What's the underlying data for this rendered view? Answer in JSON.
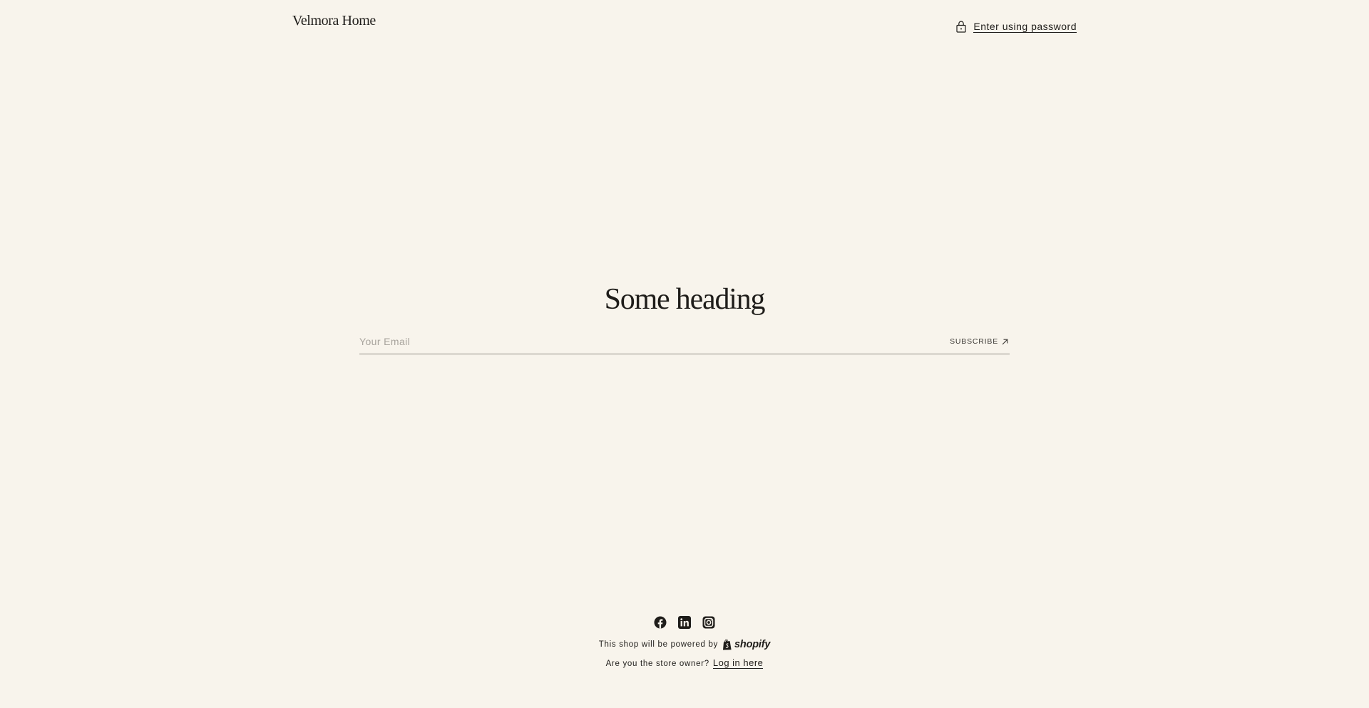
{
  "header": {
    "brand": "Velmora Home",
    "password_link": "Enter using password",
    "password_icon": "lock-icon"
  },
  "hero": {
    "heading": "Some heading",
    "email_placeholder": "Your Email",
    "subscribe_label": "SUBSCRIBE",
    "subscribe_icon": "arrow-up-right-icon"
  },
  "footer": {
    "socials": [
      {
        "name": "Facebook",
        "icon": "facebook-icon"
      },
      {
        "name": "LinkedIn",
        "icon": "linkedin-icon"
      },
      {
        "name": "Instagram",
        "icon": "instagram-icon"
      }
    ],
    "powered_text": "This shop will be powered by",
    "shopify_wordmark": "shopify",
    "owner_text": "Are you the store owner?",
    "login_link": "Log in here"
  },
  "colors": {
    "background": "#f8f4ec",
    "text": "#1f1d1a",
    "placeholder": "#a8a49d",
    "divider": "#8f8b85"
  }
}
